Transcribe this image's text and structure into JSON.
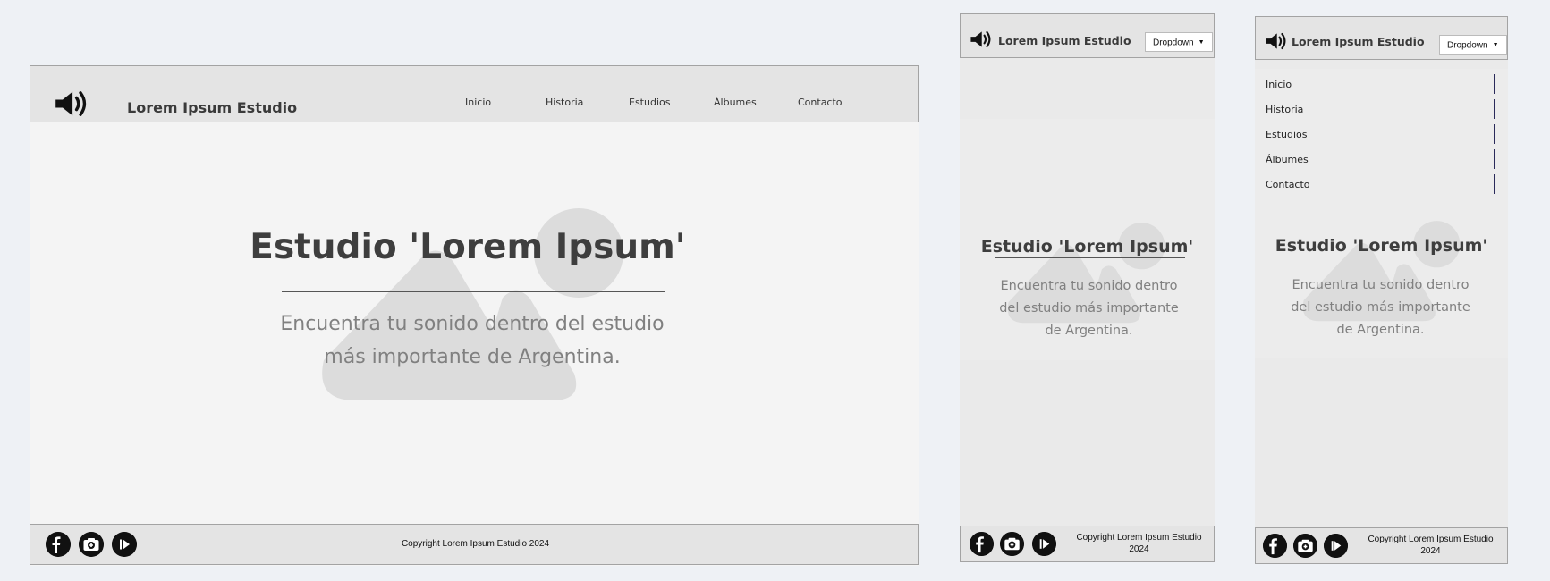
{
  "brand": {
    "name": "Lorem Ipsum Estudio",
    "logo_icon": "speaker-icon"
  },
  "nav": {
    "items": [
      "Inicio",
      "Historia",
      "Estudios",
      "Álbumes",
      "Contacto"
    ]
  },
  "hero": {
    "title": "Estudio 'Lorem Ipsum'",
    "subtitle": "Encuentra tu sonido dentro del estudio más importante de Argentina.",
    "image_icon": "image-placeholder-icon"
  },
  "mobile": {
    "dropdown_label": "Dropdown",
    "dropdown_icon": "caret-down-icon"
  },
  "footer": {
    "copyright": "Copyright Lorem Ipsum Estudio 2024",
    "social_icons": [
      "facebook-icon",
      "camera-icon",
      "play-icon"
    ]
  },
  "colors": {
    "page_bg": "#eef1f5",
    "bar_bg": "#e4e4e4",
    "hero_bg": "#f4f4f4",
    "text_dark": "#3e3e3e",
    "text_muted": "#808080"
  }
}
